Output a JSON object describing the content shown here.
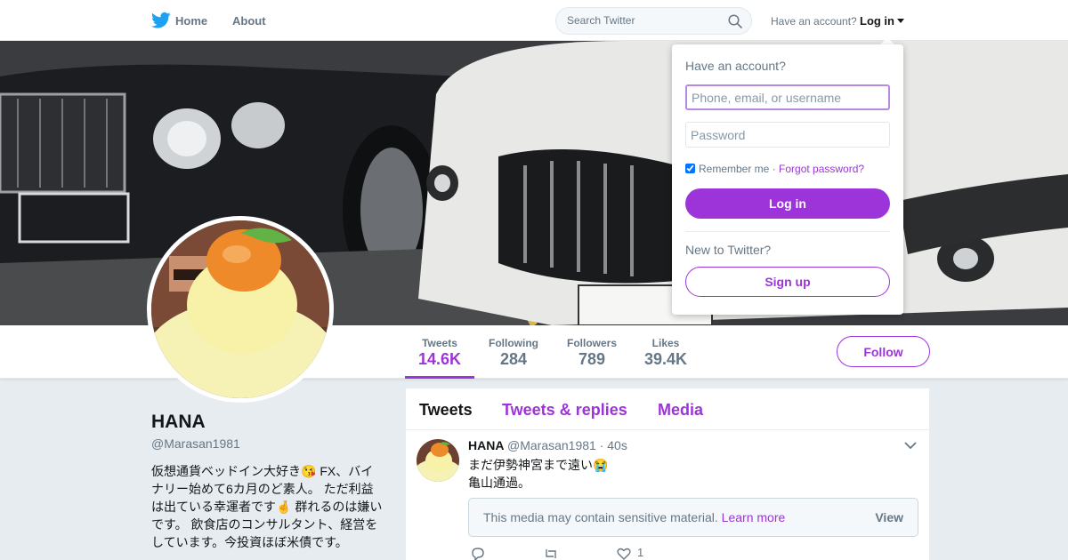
{
  "nav": {
    "home_label": "Home",
    "about_label": "About",
    "search_placeholder": "Search Twitter",
    "have_account": "Have an account?",
    "login_label": "Log in"
  },
  "profile": {
    "name": "HANA",
    "handle": "@Marasan1981",
    "bio": "仮想通貨ベッドイン大好き😘 FX、バイナリー始めて6カ月のど素人。 ただ利益は出ている幸運者です🤞 群れるのは嫌いです。 飲食店のコンサルタント、経営をしています。今投資ほぼ米債です。",
    "stats": [
      {
        "label": "Tweets",
        "value": "14.6K"
      },
      {
        "label": "Following",
        "value": "284"
      },
      {
        "label": "Followers",
        "value": "789"
      },
      {
        "label": "Likes",
        "value": "39.4K"
      }
    ],
    "follow_label": "Follow"
  },
  "timeline": {
    "tabs": [
      "Tweets",
      "Tweets & replies",
      "Media"
    ],
    "tweet": {
      "name": "HANA",
      "handle": "@Marasan1981 · 40s",
      "text_line1": "まだ伊勢神宮まで遠い😭",
      "text_line2": "亀山通過。",
      "sensitive_msg": "This media may contain sensitive material.",
      "learn_more": "Learn more",
      "view_label": "View",
      "like_count": "1"
    }
  },
  "login_dropdown": {
    "title": "Have an account?",
    "username_placeholder": "Phone, email, or username",
    "password_placeholder": "Password",
    "remember_label": "Remember me ·",
    "forgot_label": "Forgot password?",
    "login_button": "Log in",
    "new_label": "New to Twitter?",
    "signup_button": "Sign up"
  },
  "colors": {
    "accent": "#9d34da",
    "twitter_blue": "#1da1f2",
    "background": "#e6ecf0"
  },
  "icons": [
    "twitter-bird-icon",
    "search-icon",
    "caret-down-icon",
    "reply-icon",
    "retweet-icon",
    "heart-icon",
    "chevron-down-icon"
  ]
}
